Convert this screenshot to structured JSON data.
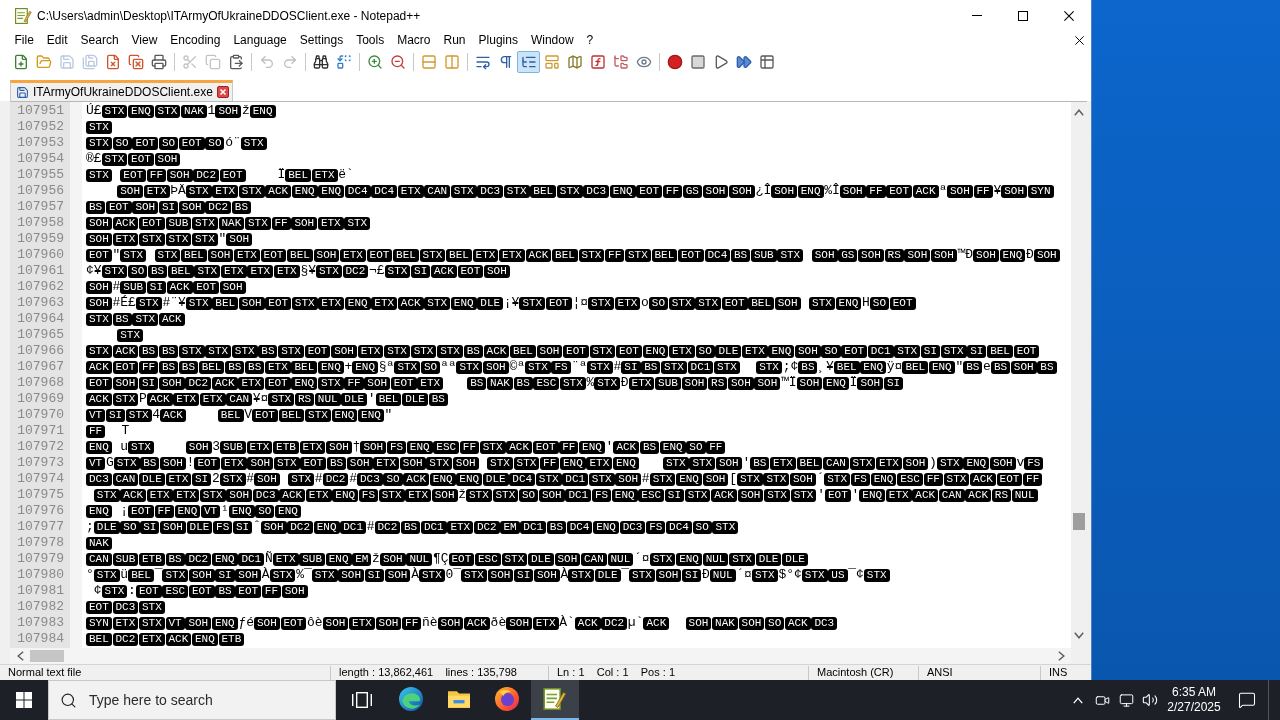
{
  "window": {
    "title": "C:\\Users\\admin\\Desktop\\ITArmyOfUkraineDDOSClient.exe - Notepad++"
  },
  "menu": [
    "File",
    "Edit",
    "Search",
    "View",
    "Encoding",
    "Language",
    "Settings",
    "Tools",
    "Macro",
    "Run",
    "Plugins",
    "Window",
    "?"
  ],
  "toolbar": [
    {
      "pressed": false,
      "disabled": false
    },
    {
      "pressed": false,
      "disabled": false
    },
    {
      "pressed": false,
      "disabled": true
    },
    {
      "pressed": false,
      "disabled": true
    },
    {
      "pressed": false,
      "disabled": false
    },
    {
      "pressed": false,
      "disabled": false
    },
    {
      "pressed": false,
      "disabled": false
    },
    {
      "pressed": false,
      "disabled": true
    },
    {
      "pressed": false,
      "disabled": true
    },
    {
      "pressed": false,
      "disabled": false
    },
    {
      "pressed": false,
      "disabled": true
    },
    {
      "pressed": false,
      "disabled": true
    },
    {
      "pressed": false,
      "disabled": false
    },
    {
      "pressed": false,
      "disabled": false
    },
    {
      "pressed": false,
      "disabled": false
    },
    {
      "pressed": false,
      "disabled": false
    },
    {
      "pressed": false,
      "disabled": false
    },
    {
      "pressed": false,
      "disabled": false
    },
    {
      "pressed": false,
      "disabled": false
    },
    {
      "pressed": false,
      "disabled": false
    },
    {
      "pressed": true,
      "disabled": false
    },
    {
      "pressed": false,
      "disabled": false
    },
    {
      "pressed": false,
      "disabled": false
    },
    {
      "pressed": false,
      "disabled": false
    },
    {
      "pressed": false,
      "disabled": false
    },
    {
      "pressed": false,
      "disabled": false
    },
    {
      "pressed": false,
      "disabled": false
    },
    {
      "pressed": false,
      "disabled": false
    },
    {
      "pressed": false,
      "disabled": false
    },
    {
      "pressed": false,
      "disabled": false
    },
    {
      "pressed": false,
      "disabled": false
    }
  ],
  "tabs": [
    {
      "label": "ITArmyOfUkraineDDOSClient.exe",
      "selected": true
    }
  ],
  "editor": {
    "lines": [
      {
        "number": "107951",
        "runs": [
          {
            "kind": "char",
            "text": "Ú£"
          },
          {
            "kind": "ctrl",
            "codes": [
              "STX",
              "ENQ",
              "STX",
              "NAK"
            ]
          },
          {
            "kind": "char",
            "text": "1"
          },
          {
            "kind": "ctrl",
            "codes": [
              "SOH"
            ]
          },
          {
            "kind": "char",
            "text": "ž"
          },
          {
            "kind": "ctrl",
            "codes": [
              "ENQ"
            ]
          }
        ]
      },
      {
        "number": "107952",
        "runs": [
          {
            "kind": "ctrl",
            "codes": [
              "STX"
            ]
          }
        ]
      },
      {
        "number": "107953",
        "runs": [
          {
            "kind": "ctrl",
            "codes": [
              "STX",
              "SO",
              "EOT",
              "SO",
              "EOT",
              "SO"
            ]
          },
          {
            "kind": "char",
            "text": "ó¨"
          },
          {
            "kind": "ctrl",
            "codes": [
              "STX"
            ]
          }
        ]
      },
      {
        "number": "107954",
        "runs": [
          {
            "kind": "char",
            "text": "®£"
          },
          {
            "kind": "ctrl",
            "codes": [
              "STX",
              "EOT",
              "SOH"
            ]
          }
        ]
      },
      {
        "number": "107955",
        "runs": [
          {
            "kind": "ctrl",
            "codes": [
              "STX"
            ]
          },
          {
            "kind": "space"
          },
          {
            "kind": "ctrl",
            "codes": [
              "EOT",
              "FF",
              "SOH",
              "DC2",
              "EOT"
            ]
          },
          {
            "kind": "space"
          },
          {
            "kind": "space"
          },
          {
            "kind": "space"
          },
          {
            "kind": "space"
          },
          {
            "kind": "char",
            "text": "Ï"
          },
          {
            "kind": "ctrl",
            "codes": [
              "BEL",
              "ETX"
            ]
          },
          {
            "kind": "char",
            "text": "ë`"
          }
        ]
      },
      {
        "number": "107956",
        "runs": [
          {
            "kind": "space"
          },
          {
            "kind": "space"
          },
          {
            "kind": "space"
          },
          {
            "kind": "space"
          },
          {
            "kind": "ctrl",
            "codes": [
              "SOH",
              "ETX"
            ]
          },
          {
            "kind": "char",
            "text": "ÞÄ"
          },
          {
            "kind": "ctrl",
            "codes": [
              "STX",
              "ETX",
              "STX",
              "ACK",
              "ENQ",
              "ENQ",
              "DC4",
              "DC4",
              "ETX",
              "CAN",
              "STX",
              "DC3",
              "STX",
              "BEL",
              "STX",
              "DC3",
              "ENQ",
              "EOT",
              "FF",
              "GS",
              "SOH",
              "SOH"
            ]
          },
          {
            "kind": "char",
            "text": "¿Î"
          },
          {
            "kind": "ctrl",
            "codes": [
              "SOH",
              "ENQ"
            ]
          },
          {
            "kind": "char",
            "text": "%Î"
          },
          {
            "kind": "ctrl",
            "codes": [
              "SOH",
              "FF",
              "EOT",
              "ACK"
            ]
          },
          {
            "kind": "char",
            "text": "ª"
          },
          {
            "kind": "ctrl",
            "codes": [
              "SOH",
              "FF"
            ]
          },
          {
            "kind": "char",
            "text": "¥"
          },
          {
            "kind": "ctrl",
            "codes": [
              "SOH",
              "SYN"
            ]
          }
        ]
      },
      {
        "number": "107957",
        "runs": [
          {
            "kind": "ctrl",
            "codes": [
              "BS",
              "EOT",
              "SOH",
              "SI",
              "SOH",
              "DC2",
              "BS"
            ]
          }
        ]
      },
      {
        "number": "107958",
        "runs": [
          {
            "kind": "ctrl",
            "codes": [
              "SOH",
              "ACK",
              "EOT",
              "SUB",
              "STX",
              "NAK",
              "STX",
              "FF",
              "SOH",
              "ETX",
              "STX"
            ]
          }
        ]
      },
      {
        "number": "107959",
        "runs": [
          {
            "kind": "ctrl",
            "codes": [
              "SOH",
              "ETX",
              "STX",
              "STX",
              "STX"
            ]
          },
          {
            "kind": "char",
            "text": "\""
          },
          {
            "kind": "ctrl",
            "codes": [
              "SOH"
            ]
          }
        ]
      },
      {
        "number": "107960",
        "runs": [
          {
            "kind": "ctrl",
            "codes": [
              "EOT"
            ]
          },
          {
            "kind": "char",
            "text": "\""
          },
          {
            "kind": "ctrl",
            "codes": [
              "STX"
            ]
          },
          {
            "kind": "space"
          },
          {
            "kind": "ctrl",
            "codes": [
              "STX",
              "BEL",
              "SOH",
              "ETX",
              "EOT",
              "BEL",
              "SOH",
              "ETX",
              "EOT",
              "BEL",
              "STX",
              "BEL",
              "ETX",
              "ETX",
              "ACK",
              "BEL",
              "STX",
              "FF",
              "STX",
              "BEL",
              "EOT",
              "DC4",
              "BS",
              "SUB",
              "STX"
            ]
          },
          {
            "kind": "space"
          },
          {
            "kind": "ctrl",
            "codes": [
              "SOH",
              "GS",
              "SOH",
              "RS",
              "SOH",
              "SOH"
            ]
          },
          {
            "kind": "char",
            "text": "™Ð"
          },
          {
            "kind": "ctrl",
            "codes": [
              "SOH",
              "ENQ"
            ]
          },
          {
            "kind": "char",
            "text": "Ð"
          },
          {
            "kind": "ctrl",
            "codes": [
              "SOH"
            ]
          }
        ]
      },
      {
        "number": "107961",
        "runs": [
          {
            "kind": "char",
            "text": "¢¥"
          },
          {
            "kind": "ctrl",
            "codes": [
              "STX",
              "SO",
              "BS",
              "BEL",
              "STX",
              "ETX",
              "ETX",
              "ETX"
            ]
          },
          {
            "kind": "char",
            "text": "§¥"
          },
          {
            "kind": "ctrl",
            "codes": [
              "STX",
              "DC2"
            ]
          },
          {
            "kind": "char",
            "text": "¬£"
          },
          {
            "kind": "ctrl",
            "codes": [
              "STX",
              "SI",
              "ACK",
              "EOT",
              "SOH"
            ]
          }
        ]
      },
      {
        "number": "107962",
        "runs": [
          {
            "kind": "ctrl",
            "codes": [
              "SOH"
            ]
          },
          {
            "kind": "char",
            "text": "#"
          },
          {
            "kind": "ctrl",
            "codes": [
              "SUB",
              "SI",
              "ACK",
              "EOT",
              "SOH"
            ]
          }
        ]
      },
      {
        "number": "107963",
        "runs": [
          {
            "kind": "ctrl",
            "codes": [
              "SOH"
            ]
          },
          {
            "kind": "char",
            "text": "#É£"
          },
          {
            "kind": "ctrl",
            "codes": [
              "STX"
            ]
          },
          {
            "kind": "char",
            "text": "#¨¥"
          },
          {
            "kind": "ctrl",
            "codes": [
              "STX",
              "BEL",
              "SOH",
              "EOT",
              "STX",
              "ETX",
              "ENQ",
              "ETX",
              "ACK",
              "STX",
              "ENQ",
              "DLE"
            ]
          },
          {
            "kind": "char",
            "text": "¡¥"
          },
          {
            "kind": "ctrl",
            "codes": [
              "STX",
              "EOT"
            ]
          },
          {
            "kind": "char",
            "text": "¦¤"
          },
          {
            "kind": "ctrl",
            "codes": [
              "STX",
              "ETX"
            ]
          },
          {
            "kind": "char",
            "text": "o"
          },
          {
            "kind": "ctrl",
            "codes": [
              "SO",
              "STX",
              "STX",
              "EOT",
              "BEL",
              "SOH"
            ]
          },
          {
            "kind": "space"
          },
          {
            "kind": "ctrl",
            "codes": [
              "STX",
              "ENQ"
            ]
          },
          {
            "kind": "char",
            "text": "H"
          },
          {
            "kind": "ctrl",
            "codes": [
              "SO",
              "EOT"
            ]
          }
        ]
      },
      {
        "number": "107964",
        "runs": [
          {
            "kind": "ctrl",
            "codes": [
              "STX",
              "BS",
              "STX",
              "ACK"
            ]
          }
        ]
      },
      {
        "number": "107965",
        "runs": [
          {
            "kind": "space"
          },
          {
            "kind": "space"
          },
          {
            "kind": "space"
          },
          {
            "kind": "space"
          },
          {
            "kind": "ctrl",
            "codes": [
              "STX"
            ]
          }
        ]
      },
      {
        "number": "107966",
        "runs": [
          {
            "kind": "ctrl",
            "codes": [
              "STX",
              "ACK",
              "BS",
              "BS",
              "STX",
              "STX",
              "STX",
              "BS",
              "STX",
              "EOT",
              "SOH",
              "ETX",
              "STX",
              "STX",
              "STX",
              "BS",
              "ACK",
              "BEL",
              "SOH",
              "EOT",
              "STX",
              "EOT",
              "ENQ",
              "ETX",
              "SO",
              "DLE",
              "ETX",
              "ENQ",
              "SOH",
              "SO",
              "EOT",
              "DC1",
              "STX",
              "SI",
              "STX",
              "SI",
              "BEL",
              "EOT"
            ]
          }
        ]
      },
      {
        "number": "107967",
        "runs": [
          {
            "kind": "ctrl",
            "codes": [
              "ACK",
              "EOT",
              "FF",
              "BS",
              "BS",
              "BEL",
              "BS",
              "BS",
              "ETX",
              "BEL",
              "ENQ"
            ]
          },
          {
            "kind": "char",
            "text": "+"
          },
          {
            "kind": "ctrl",
            "codes": [
              "ENQ"
            ]
          },
          {
            "kind": "char",
            "text": "§ª"
          },
          {
            "kind": "ctrl",
            "codes": [
              "STX",
              "SO"
            ]
          },
          {
            "kind": "char",
            "text": "ªª"
          },
          {
            "kind": "ctrl",
            "codes": [
              "STX",
              "SOH"
            ]
          },
          {
            "kind": "char",
            "text": "©ª"
          },
          {
            "kind": "ctrl",
            "codes": [
              "STX",
              "FS"
            ]
          },
          {
            "kind": "char",
            "text": "¨ª"
          },
          {
            "kind": "ctrl",
            "codes": [
              "STX"
            ]
          },
          {
            "kind": "char",
            "text": "#"
          },
          {
            "kind": "ctrl",
            "codes": [
              "SI",
              "BS",
              "STX",
              "DC1",
              "STX"
            ]
          },
          {
            "kind": "space"
          },
          {
            "kind": "space"
          },
          {
            "kind": "ctrl",
            "codes": [
              "STX"
            ]
          },
          {
            "kind": "char",
            "text": ";¢"
          },
          {
            "kind": "ctrl",
            "codes": [
              "BS"
            ]
          },
          {
            "kind": "char",
            "text": "¸¥"
          },
          {
            "kind": "ctrl",
            "codes": [
              "BEL",
              "ENQ"
            ]
          },
          {
            "kind": "char",
            "text": "ÿ¤"
          },
          {
            "kind": "ctrl",
            "codes": [
              "BEL",
              "ENQ"
            ]
          },
          {
            "kind": "char",
            "text": "\""
          },
          {
            "kind": "ctrl",
            "codes": [
              "BS"
            ]
          },
          {
            "kind": "char",
            "text": "e"
          },
          {
            "kind": "ctrl",
            "codes": [
              "BS",
              "SOH",
              "BS"
            ]
          }
        ]
      },
      {
        "number": "107968",
        "runs": [
          {
            "kind": "ctrl",
            "codes": [
              "EOT",
              "SOH",
              "SI",
              "SOH",
              "DC2",
              "ACK",
              "ETX",
              "EOT",
              "ENQ",
              "STX",
              "FF",
              "SOH",
              "EOT",
              "ETX"
            ]
          },
          {
            "kind": "space"
          },
          {
            "kind": "space"
          },
          {
            "kind": "space"
          },
          {
            "kind": "ctrl",
            "codes": [
              "BS",
              "NAK",
              "BS",
              "ESC",
              "STX"
            ]
          },
          {
            "kind": "char",
            "text": "%"
          },
          {
            "kind": "ctrl",
            "codes": [
              "STX"
            ]
          },
          {
            "kind": "char",
            "text": "Ð"
          },
          {
            "kind": "ctrl",
            "codes": [
              "ETX",
              "SUB",
              "SOH",
              "RS",
              "SOH",
              "SOH"
            ]
          },
          {
            "kind": "char",
            "text": "™Ï"
          },
          {
            "kind": "ctrl",
            "codes": [
              "SOH",
              "ENQ"
            ]
          },
          {
            "kind": "char",
            "text": "Ï"
          },
          {
            "kind": "ctrl",
            "codes": [
              "SOH",
              "SI"
            ]
          }
        ]
      },
      {
        "number": "107969",
        "runs": [
          {
            "kind": "ctrl",
            "codes": [
              "ACK",
              "STX"
            ]
          },
          {
            "kind": "char",
            "text": "P"
          },
          {
            "kind": "ctrl",
            "codes": [
              "ACK",
              "ETX",
              "ETX",
              "CAN"
            ]
          },
          {
            "kind": "char",
            "text": "¥¤"
          },
          {
            "kind": "ctrl",
            "codes": [
              "STX",
              "RS",
              "NUL",
              "DLE"
            ]
          },
          {
            "kind": "char",
            "text": "'"
          },
          {
            "kind": "ctrl",
            "codes": [
              "BEL",
              "DLE",
              "BS"
            ]
          }
        ]
      },
      {
        "number": "107970",
        "runs": [
          {
            "kind": "ctrl",
            "codes": [
              "VT",
              "SI",
              "STX"
            ]
          },
          {
            "kind": "char",
            "text": "4"
          },
          {
            "kind": "ctrl",
            "codes": [
              "ACK"
            ]
          },
          {
            "kind": "space"
          },
          {
            "kind": "space"
          },
          {
            "kind": "space"
          },
          {
            "kind": "space"
          },
          {
            "kind": "ctrl",
            "codes": [
              "BEL"
            ]
          },
          {
            "kind": "char",
            "text": "V"
          },
          {
            "kind": "ctrl",
            "codes": [
              "EOT",
              "BEL",
              "STX",
              "ENQ",
              "ENQ"
            ]
          },
          {
            "kind": "char",
            "text": "\""
          }
        ]
      },
      {
        "number": "107971",
        "runs": [
          {
            "kind": "ctrl",
            "codes": [
              "FF"
            ]
          },
          {
            "kind": "space"
          },
          {
            "kind": "space"
          },
          {
            "kind": "char",
            "text": "T"
          }
        ]
      },
      {
        "number": "107972",
        "runs": [
          {
            "kind": "ctrl",
            "codes": [
              "ENQ"
            ]
          },
          {
            "kind": "space"
          },
          {
            "kind": "char",
            "text": "u"
          },
          {
            "kind": "ctrl",
            "codes": [
              "STX"
            ]
          },
          {
            "kind": "space"
          },
          {
            "kind": "space"
          },
          {
            "kind": "space"
          },
          {
            "kind": "space"
          },
          {
            "kind": "ctrl",
            "codes": [
              "SOH"
            ]
          },
          {
            "kind": "char",
            "text": "3"
          },
          {
            "kind": "ctrl",
            "codes": [
              "SUB",
              "ETX",
              "ETB",
              "ETX",
              "SOH"
            ]
          },
          {
            "kind": "char",
            "text": "†"
          },
          {
            "kind": "ctrl",
            "codes": [
              "SOH",
              "FS",
              "ENQ",
              "ESC",
              "FF",
              "STX",
              "ACK",
              "EOT",
              "FF",
              "ENQ"
            ]
          },
          {
            "kind": "char",
            "text": "'"
          },
          {
            "kind": "ctrl",
            "codes": [
              "ACK",
              "BS",
              "ENQ",
              "SO",
              "FF"
            ]
          }
        ]
      },
      {
        "number": "107973",
        "runs": [
          {
            "kind": "ctrl",
            "codes": [
              "VT"
            ]
          },
          {
            "kind": "char",
            "text": "G"
          },
          {
            "kind": "ctrl",
            "codes": [
              "STX",
              "BS",
              "SOH"
            ]
          },
          {
            "kind": "char",
            "text": "!"
          },
          {
            "kind": "ctrl",
            "codes": [
              "EOT",
              "ETX",
              "SOH",
              "STX",
              "EOT",
              "BS",
              "SOH",
              "ETX",
              "SOH",
              "STX",
              "SOH"
            ]
          },
          {
            "kind": "space"
          },
          {
            "kind": "ctrl",
            "codes": [
              "STX",
              "STX",
              "FF",
              "ENQ",
              "ETX",
              "ENQ"
            ]
          },
          {
            "kind": "space"
          },
          {
            "kind": "space"
          },
          {
            "kind": "space"
          },
          {
            "kind": "ctrl",
            "codes": [
              "STX",
              "STX",
              "SOH"
            ]
          },
          {
            "kind": "char",
            "text": "'"
          },
          {
            "kind": "ctrl",
            "codes": [
              "BS",
              "ETX",
              "BEL",
              "CAN",
              "STX",
              "ETX",
              "SOH"
            ]
          },
          {
            "kind": "char",
            "text": ")"
          },
          {
            "kind": "ctrl",
            "codes": [
              "STX",
              "ENQ",
              "SOH"
            ]
          },
          {
            "kind": "char",
            "text": "v"
          },
          {
            "kind": "ctrl",
            "codes": [
              "FS"
            ]
          }
        ]
      },
      {
        "number": "107974",
        "runs": [
          {
            "kind": "ctrl",
            "codes": [
              "DC3",
              "CAN",
              "DLE",
              "ETX",
              "SI"
            ]
          },
          {
            "kind": "char",
            "text": "2"
          },
          {
            "kind": "ctrl",
            "codes": [
              "STX"
            ]
          },
          {
            "kind": "char",
            "text": "#"
          },
          {
            "kind": "ctrl",
            "codes": [
              "SOH"
            ]
          },
          {
            "kind": "space"
          },
          {
            "kind": "ctrl",
            "codes": [
              "STX"
            ]
          },
          {
            "kind": "char",
            "text": "#"
          },
          {
            "kind": "ctrl",
            "codes": [
              "DC2"
            ]
          },
          {
            "kind": "char",
            "text": "#"
          },
          {
            "kind": "ctrl",
            "codes": [
              "DC3",
              "SO",
              "ACK",
              "ENQ",
              "ENQ",
              "DLE",
              "DC4",
              "STX",
              "DC1",
              "STX",
              "SOH"
            ]
          },
          {
            "kind": "char",
            "text": "#"
          },
          {
            "kind": "ctrl",
            "codes": [
              "STX",
              "ENQ",
              "SOH"
            ]
          },
          {
            "kind": "char",
            "text": "["
          },
          {
            "kind": "ctrl",
            "codes": [
              "STX",
              "STX",
              "SOH"
            ]
          },
          {
            "kind": "char",
            "text": "´"
          },
          {
            "kind": "ctrl",
            "codes": [
              "STX",
              "FS",
              "ENQ",
              "ESC",
              "FF",
              "STX",
              "ACK",
              "EOT",
              "FF"
            ]
          }
        ]
      },
      {
        "number": "107975",
        "runs": [
          {
            "kind": "space"
          },
          {
            "kind": "ctrl",
            "codes": [
              "STX",
              "ACK",
              "ETX",
              "ETX",
              "STX",
              "SOH",
              "DC3",
              "ACK",
              "ETX",
              "ENQ",
              "FS",
              "STX",
              "ETX",
              "SOH"
            ]
          },
          {
            "kind": "char",
            "text": "ž"
          },
          {
            "kind": "ctrl",
            "codes": [
              "STX",
              "STX",
              "SO",
              "SOH",
              "DC1",
              "FS",
              "ENQ",
              "ESC",
              "SI",
              "STX",
              "ACK",
              "SOH",
              "STX",
              "STX"
            ]
          },
          {
            "kind": "char",
            "text": "'"
          },
          {
            "kind": "ctrl",
            "codes": [
              "EOT"
            ]
          },
          {
            "kind": "char",
            "text": "'"
          },
          {
            "kind": "ctrl",
            "codes": [
              "ENQ",
              "ETX",
              "ACK",
              "CAN",
              "ACK",
              "RS",
              "NUL"
            ]
          }
        ]
      },
      {
        "number": "107976",
        "runs": [
          {
            "kind": "ctrl",
            "codes": [
              "ENQ"
            ]
          },
          {
            "kind": "space"
          },
          {
            "kind": "char",
            "text": "¡"
          },
          {
            "kind": "ctrl",
            "codes": [
              "EOT",
              "FF",
              "ENQ",
              "VT"
            ]
          },
          {
            "kind": "char",
            "text": "¹"
          },
          {
            "kind": "ctrl",
            "codes": [
              "ENQ",
              "SO",
              "ENQ"
            ]
          }
        ]
      },
      {
        "number": "107977",
        "runs": [
          {
            "kind": "char",
            "text": ";"
          },
          {
            "kind": "ctrl",
            "codes": [
              "DLE",
              "SO",
              "SI",
              "SOH",
              "DLE",
              "FS",
              "SI"
            ]
          },
          {
            "kind": "char",
            "text": "ˆ"
          },
          {
            "kind": "ctrl",
            "codes": [
              "SOH",
              "DC2",
              "ENQ",
              "DC1"
            ]
          },
          {
            "kind": "char",
            "text": "#"
          },
          {
            "kind": "ctrl",
            "codes": [
              "DC2",
              "BS",
              "DC1",
              "ETX",
              "DC2",
              "EM",
              "DC1",
              "BS",
              "DC4",
              "ENQ",
              "DC3",
              "FS",
              "DC4",
              "SO",
              "STX"
            ]
          }
        ]
      },
      {
        "number": "107978",
        "runs": [
          {
            "kind": "ctrl",
            "codes": [
              "NAK"
            ]
          }
        ]
      },
      {
        "number": "107979",
        "runs": [
          {
            "kind": "ctrl",
            "codes": [
              "CAN",
              "SUB",
              "ETB",
              "BS",
              "DC2",
              "ENQ",
              "DC1"
            ]
          },
          {
            "kind": "char",
            "text": "Ñ"
          },
          {
            "kind": "ctrl",
            "codes": [
              "ETX",
              "SUB",
              "ENQ",
              "EM"
            ]
          },
          {
            "kind": "char",
            "text": "ž"
          },
          {
            "kind": "ctrl",
            "codes": [
              "SOH",
              "NUL"
            ]
          },
          {
            "kind": "char",
            "text": "¶Ç"
          },
          {
            "kind": "ctrl",
            "codes": [
              "EOT",
              "ESC",
              "STX",
              "DLE",
              "SOH",
              "CAN",
              "NUL"
            ]
          },
          {
            "kind": "char",
            "text": "´¤"
          },
          {
            "kind": "ctrl",
            "codes": [
              "STX",
              "ENQ",
              "NUL",
              "STX",
              "DLE",
              "DLE"
            ]
          }
        ]
      },
      {
        "number": "107980",
        "runs": [
          {
            "kind": "char",
            "text": "°"
          },
          {
            "kind": "ctrl",
            "codes": [
              "STX"
            ]
          },
          {
            "kind": "char",
            "text": "ü"
          },
          {
            "kind": "ctrl",
            "codes": [
              "BEL"
            ]
          },
          {
            "kind": "char",
            "text": "¯"
          },
          {
            "kind": "ctrl",
            "codes": [
              "STX",
              "SOH",
              "SI",
              "SOH"
            ]
          },
          {
            "kind": "char",
            "text": "À"
          },
          {
            "kind": "ctrl",
            "codes": [
              "STX"
            ]
          },
          {
            "kind": "char",
            "text": "%¯"
          },
          {
            "kind": "ctrl",
            "codes": [
              "STX",
              "SOH",
              "SI",
              "SOH"
            ]
          },
          {
            "kind": "char",
            "text": "À"
          },
          {
            "kind": "ctrl",
            "codes": [
              "STX"
            ]
          },
          {
            "kind": "char",
            "text": "0¯"
          },
          {
            "kind": "ctrl",
            "codes": [
              "STX",
              "SOH",
              "SI",
              "SOH"
            ]
          },
          {
            "kind": "char",
            "text": "À"
          },
          {
            "kind": "ctrl",
            "codes": [
              "STX",
              "DLE"
            ]
          },
          {
            "kind": "char",
            "text": "¯"
          },
          {
            "kind": "ctrl",
            "codes": [
              "STX",
              "SOH",
              "SI"
            ]
          },
          {
            "kind": "char",
            "text": "Ð"
          },
          {
            "kind": "ctrl",
            "codes": [
              "NUL"
            ]
          },
          {
            "kind": "char",
            "text": "´¤"
          },
          {
            "kind": "ctrl",
            "codes": [
              "STX"
            ]
          },
          {
            "kind": "char",
            "text": "$°¢"
          },
          {
            "kind": "ctrl",
            "codes": [
              "STX",
              "US"
            ]
          },
          {
            "kind": "char",
            "text": "¯¢"
          },
          {
            "kind": "ctrl",
            "codes": [
              "STX"
            ]
          }
        ]
      },
      {
        "number": "107981",
        "runs": [
          {
            "kind": "space"
          },
          {
            "kind": "char",
            "text": "¢"
          },
          {
            "kind": "ctrl",
            "codes": [
              "STX"
            ]
          },
          {
            "kind": "char",
            "text": ":"
          },
          {
            "kind": "ctrl",
            "codes": [
              "EOT",
              "ESC",
              "EOT",
              "BS",
              "EOT",
              "FF",
              "SOH"
            ]
          }
        ]
      },
      {
        "number": "107982",
        "runs": [
          {
            "kind": "ctrl",
            "codes": [
              "EOT",
              "DC3",
              "STX"
            ]
          }
        ]
      },
      {
        "number": "107983",
        "runs": [
          {
            "kind": "ctrl",
            "codes": [
              "SYN",
              "ETX",
              "STX",
              "VT",
              "SOH",
              "ENQ"
            ]
          },
          {
            "kind": "char",
            "text": "ƒé"
          },
          {
            "kind": "ctrl",
            "codes": [
              "SOH",
              "EOT"
            ]
          },
          {
            "kind": "char",
            "text": "ôè"
          },
          {
            "kind": "ctrl",
            "codes": [
              "SOH",
              "ETX",
              "SOH",
              "FF"
            ]
          },
          {
            "kind": "char",
            "text": "ñè"
          },
          {
            "kind": "ctrl",
            "codes": [
              "SOH",
              "ACK"
            ]
          },
          {
            "kind": "char",
            "text": "ðè"
          },
          {
            "kind": "ctrl",
            "codes": [
              "SOH",
              "ETX"
            ]
          },
          {
            "kind": "char",
            "text": "À`"
          },
          {
            "kind": "ctrl",
            "codes": [
              "ACK",
              "DC2"
            ]
          },
          {
            "kind": "char",
            "text": "µ`"
          },
          {
            "kind": "ctrl",
            "codes": [
              "ACK"
            ]
          },
          {
            "kind": "space"
          },
          {
            "kind": "space"
          },
          {
            "kind": "ctrl",
            "codes": [
              "SOH",
              "NAK",
              "SOH",
              "SO",
              "ACK",
              "DC3"
            ]
          }
        ]
      },
      {
        "number": "107984",
        "runs": [
          {
            "kind": "ctrl",
            "codes": [
              "BEL",
              "DC2",
              "ETX",
              "ACK",
              "ENQ",
              "ETB"
            ]
          }
        ]
      }
    ]
  },
  "status_bar": [
    "Normal text file",
    "length : 13,862,461    lines : 135,798",
    "Ln : 1    Col : 1    Pos : 1",
    "Macintosh (CR)",
    "ANSI",
    "INS"
  ],
  "taskbar": {
    "search": {
      "placeholder": "Type here to search"
    },
    "apps": [
      {
        "active": false
      },
      {
        "active": false
      },
      {
        "active": false
      },
      {
        "active": true
      }
    ],
    "clock": {
      "time": "6:35 AM",
      "date": "2/27/2025"
    }
  }
}
